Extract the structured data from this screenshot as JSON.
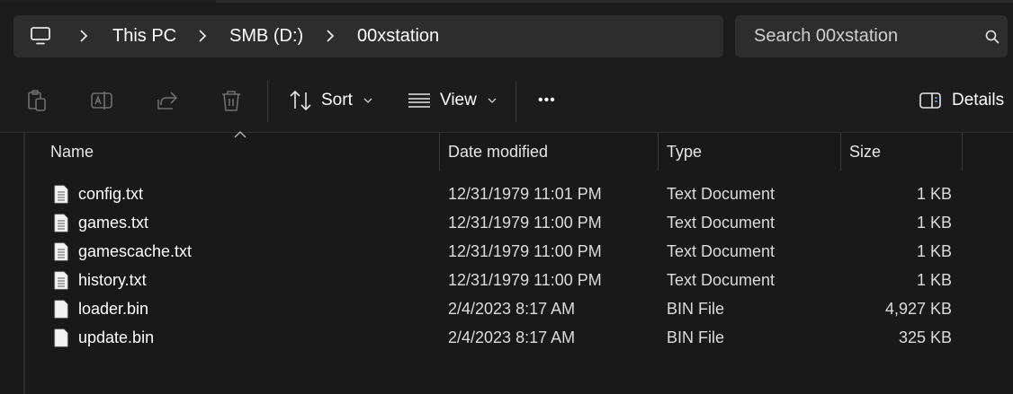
{
  "address": {
    "crumbs": [
      "This PC",
      "SMB (D:)",
      "00xstation"
    ]
  },
  "search": {
    "placeholder": "Search 00xstation"
  },
  "toolbar": {
    "sort_label": "Sort",
    "view_label": "View",
    "details_label": "Details",
    "more_label": "•••"
  },
  "columns": {
    "name": "Name",
    "date": "Date modified",
    "type": "Type",
    "size": "Size"
  },
  "files": [
    {
      "name": "config.txt",
      "date": "12/31/1979 11:01 PM",
      "type": "Text Document",
      "size": "1 KB",
      "icon": "text-file-icon"
    },
    {
      "name": "games.txt",
      "date": "12/31/1979 11:00 PM",
      "type": "Text Document",
      "size": "1 KB",
      "icon": "text-file-icon"
    },
    {
      "name": "gamescache.txt",
      "date": "12/31/1979 11:00 PM",
      "type": "Text Document",
      "size": "1 KB",
      "icon": "text-file-icon"
    },
    {
      "name": "history.txt",
      "date": "12/31/1979 11:00 PM",
      "type": "Text Document",
      "size": "1 KB",
      "icon": "text-file-icon"
    },
    {
      "name": "loader.bin",
      "date": "2/4/2023 8:17 AM",
      "type": "BIN File",
      "size": "4,927 KB",
      "icon": "blank-file-icon"
    },
    {
      "name": "update.bin",
      "date": "2/4/2023 8:17 AM",
      "type": "BIN File",
      "size": "325 KB",
      "icon": "blank-file-icon"
    }
  ],
  "colors": {
    "background": "#191919",
    "bar": "#2d2d2d",
    "text": "#ffffff",
    "muted_icon": "#7a7a7a"
  }
}
